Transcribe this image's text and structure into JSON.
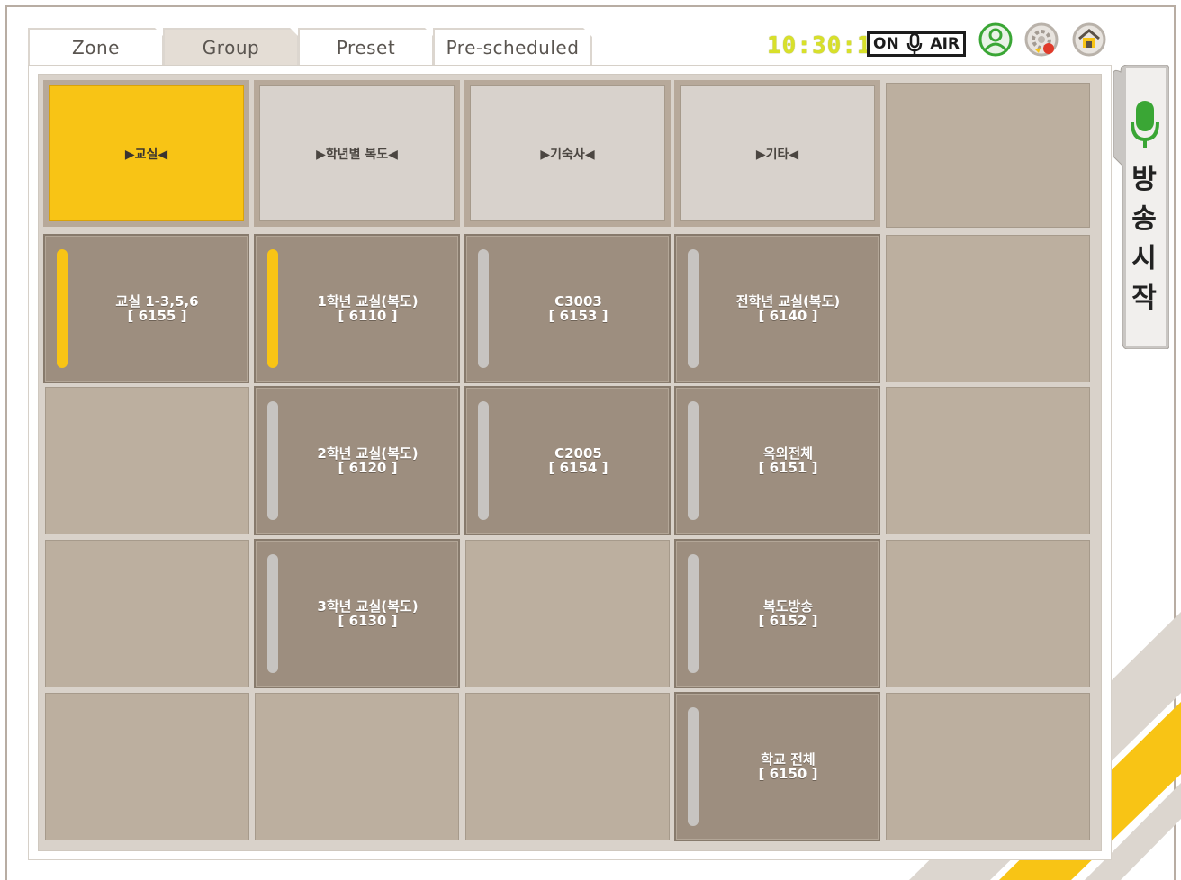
{
  "tabs": [
    {
      "label": "Zone",
      "active": false
    },
    {
      "label": "Group",
      "active": true
    },
    {
      "label": "Preset",
      "active": false
    },
    {
      "label": "Pre-scheduled",
      "active": false
    }
  ],
  "header": {
    "clock": "10:30:17",
    "on_air_left": "ON",
    "on_air_right": "AIR",
    "icons": [
      "user-icon",
      "settings-icon",
      "home-icon"
    ]
  },
  "side_button": {
    "label": "방송시작",
    "chars": [
      "방",
      "송",
      "시",
      "작"
    ],
    "icon": "microphone-icon"
  },
  "groups": [
    {
      "label": "▶교실◀",
      "selected": true
    },
    {
      "label": "▶학년별 복도◀",
      "selected": false
    },
    {
      "label": "▶기숙사◀",
      "selected": false
    },
    {
      "label": "▶기타◀",
      "selected": false
    }
  ],
  "zones": [
    {
      "name": "교실 1-3,5,6",
      "code": "[ 6155 ]",
      "active": true
    },
    {
      "name": "1학년 교실(복도)",
      "code": "[ 6110 ]",
      "active": true
    },
    {
      "name": "C3003",
      "code": "[ 6153 ]",
      "active": false
    },
    {
      "name": "전학년 교실(복도)",
      "code": "[ 6140 ]",
      "active": false
    },
    {
      "name": "2학년 교실(복도)",
      "code": "[ 6120 ]",
      "active": false
    },
    {
      "name": "C2005",
      "code": "[ 6154 ]",
      "active": false
    },
    {
      "name": "옥외전체",
      "code": "[ 6151 ]",
      "active": false
    },
    {
      "name": "3학년 교실(복도)",
      "code": "[ 6130 ]",
      "active": false
    },
    {
      "name": "복도방송",
      "code": "[ 6152 ]",
      "active": false
    },
    {
      "name": "학교 전체",
      "code": "[ 6150 ]",
      "active": false
    }
  ],
  "colors": {
    "accent_yellow": "#f8c415",
    "panel": "#bcaf9f",
    "zone_bg": "#9d8e7f",
    "clock": "#d8e02a",
    "mic_green": "#3aa635"
  }
}
